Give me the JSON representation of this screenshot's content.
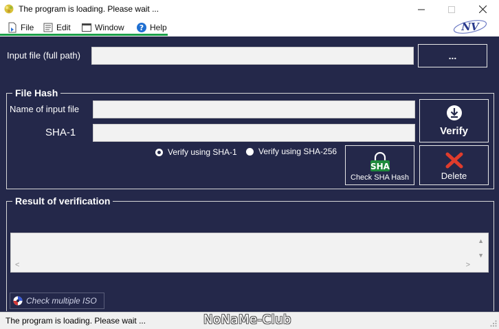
{
  "window": {
    "title": "The program is loading. Please wait ...",
    "minimize_icon": "minimize-icon",
    "maximize_icon": "maximize-icon",
    "close_icon": "close-icon"
  },
  "menu": {
    "items": [
      {
        "label": "File",
        "icon": "file-icon"
      },
      {
        "label": "Edit",
        "icon": "edit-icon"
      },
      {
        "label": "Window",
        "icon": "window-icon"
      },
      {
        "label": "Help",
        "icon": "help-icon"
      }
    ],
    "logo_text": "NV"
  },
  "input_file": {
    "label": "Input file (full path)",
    "value": "",
    "browse_label": "..."
  },
  "file_hash": {
    "title": "File Hash",
    "name_label": "Name of input file",
    "name_value": "",
    "sha_label": "SHA-1",
    "sha_value": "",
    "verify_label": "Verify",
    "radio_sha1": "Verify using SHA-1",
    "radio_sha256": "Verify using SHA-256",
    "radio_selected": "sha256",
    "check_sha_icon_text": "SHA",
    "check_sha_label": "Check SHA Hash",
    "delete_label": "Delete"
  },
  "result": {
    "title": "Result of verification",
    "value": ""
  },
  "check_multiple": {
    "label": "Check multiple ISO"
  },
  "status": {
    "text": "The program is loading. Please wait ...",
    "watermark": "NoNaMe-Club"
  },
  "colors": {
    "panel_bg": "#24284a",
    "menu_accent": "#1ca04a",
    "delete_icon": "#e03c2c",
    "sha_badge": "#1e8a3c"
  }
}
